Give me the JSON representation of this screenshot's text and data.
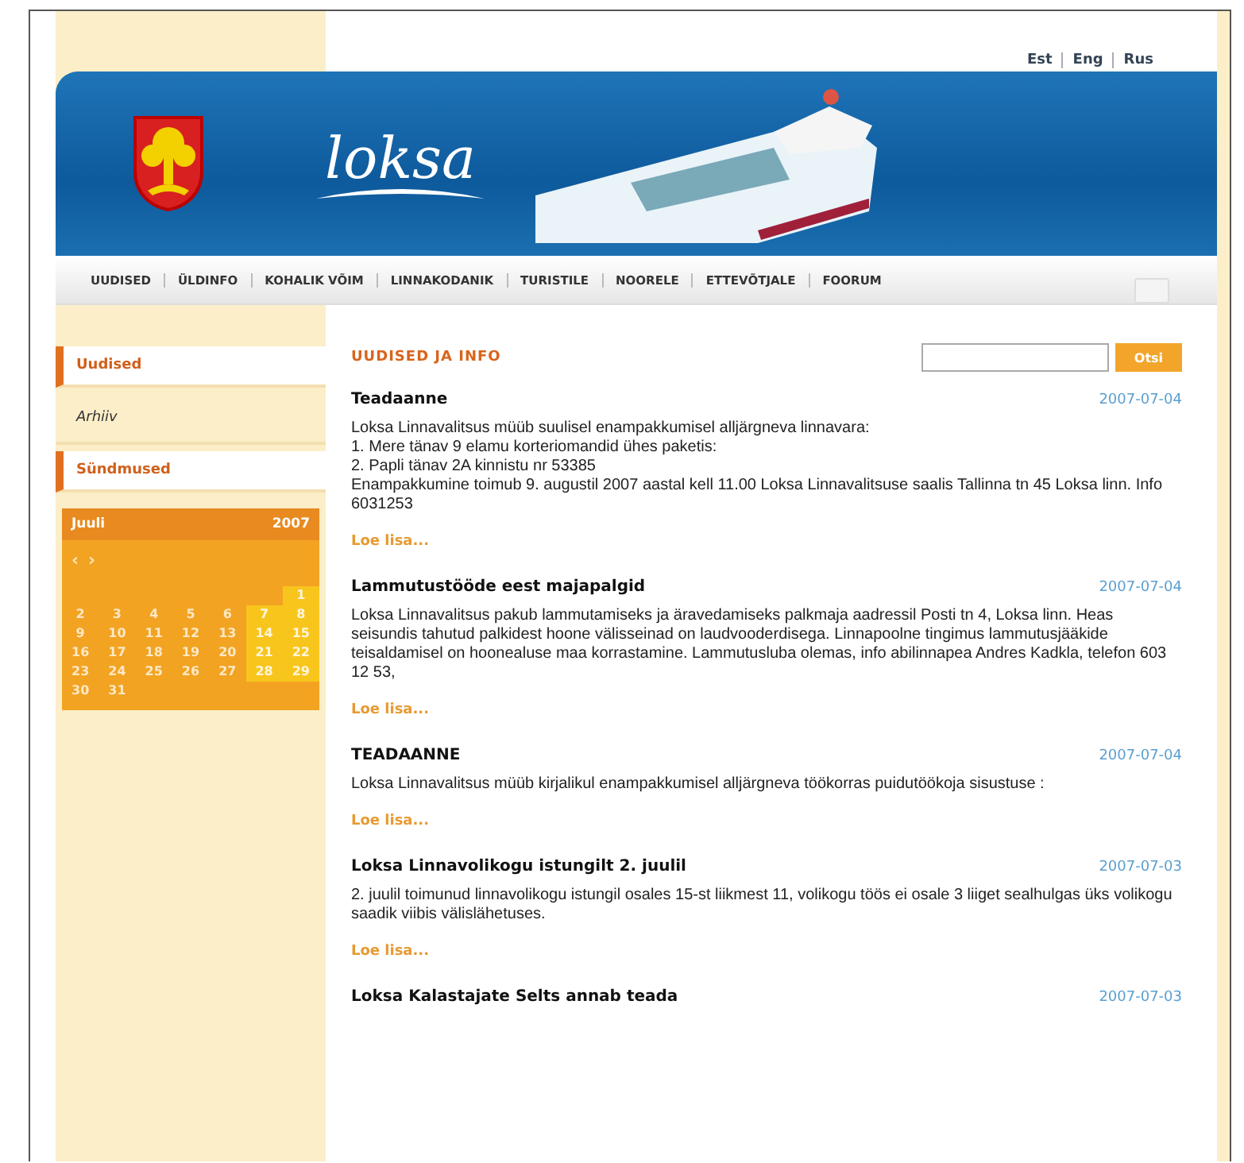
{
  "header": {
    "logo": "loksa",
    "languages": [
      {
        "label": "Est"
      },
      {
        "label": "Eng"
      },
      {
        "label": "Rus"
      }
    ]
  },
  "nav": [
    {
      "label": "UUDISED"
    },
    {
      "label": "ÜLDINFO"
    },
    {
      "label": "KOHALIK VÕIM"
    },
    {
      "label": "LINNAKODANIK"
    },
    {
      "label": "TURISTILE"
    },
    {
      "label": "NOORELE"
    },
    {
      "label": "ETTEVÕTJALE"
    },
    {
      "label": "FOORUM"
    }
  ],
  "sidebar": {
    "items": [
      {
        "label": "Uudised",
        "kind": "section"
      },
      {
        "label": "Arhiiv",
        "kind": "sub"
      },
      {
        "label": "Sündmused",
        "kind": "section"
      }
    ]
  },
  "calendar": {
    "month": "Juuli",
    "year": "2007",
    "prev": "‹",
    "next": "›",
    "weeks": [
      [
        {
          "day": "1",
          "weekend": true
        }
      ],
      [
        {
          "day": "2",
          "weekend": false
        },
        {
          "day": "3",
          "weekend": false
        },
        {
          "day": "4",
          "weekend": false
        },
        {
          "day": "5",
          "weekend": false
        },
        {
          "day": "6",
          "weekend": false
        },
        {
          "day": "7",
          "weekend": true
        },
        {
          "day": "8",
          "weekend": true
        }
      ],
      [
        {
          "day": "9",
          "weekend": false
        },
        {
          "day": "10",
          "weekend": false
        },
        {
          "day": "11",
          "weekend": false
        },
        {
          "day": "12",
          "weekend": false
        },
        {
          "day": "13",
          "weekend": false
        },
        {
          "day": "14",
          "weekend": true
        },
        {
          "day": "15",
          "weekend": true
        }
      ],
      [
        {
          "day": "16",
          "weekend": false
        },
        {
          "day": "17",
          "weekend": false
        },
        {
          "day": "18",
          "weekend": false
        },
        {
          "day": "19",
          "weekend": false
        },
        {
          "day": "20",
          "weekend": false
        },
        {
          "day": "21",
          "weekend": true
        },
        {
          "day": "22",
          "weekend": true
        }
      ],
      [
        {
          "day": "23",
          "weekend": false
        },
        {
          "day": "24",
          "weekend": false
        },
        {
          "day": "25",
          "weekend": false
        },
        {
          "day": "26",
          "weekend": false
        },
        {
          "day": "27",
          "weekend": false
        },
        {
          "day": "28",
          "weekend": true
        },
        {
          "day": "29",
          "weekend": true
        }
      ],
      [
        {
          "day": "30",
          "weekend": false
        },
        {
          "day": "31",
          "weekend": false
        }
      ]
    ]
  },
  "main": {
    "heading": "UUDISED JA INFO",
    "search": {
      "button": "Otsi"
    },
    "news": [
      {
        "title": "Teadaanne",
        "date": "2007-07-04",
        "body": [
          "Loksa Linnavalitsus müüb suulisel enampakkumisel alljärgneva linnavara:",
          "1. Mere tänav 9 elamu korteriomandid ühes paketis:",
          "2. Papli tänav 2A kinnistu nr 53385",
          "Enampakkumine toimub 9. augustil 2007 aastal kell 11.00 Loksa Linnavalitsuse saalis Tallinna tn 45 Loksa linn. Info 6031253"
        ],
        "more": "Loe lisa..."
      },
      {
        "title": "Lammutustööde eest majapalgid",
        "date": "2007-07-04",
        "body": [
          "Loksa Linnavalitsus pakub lammutamiseks ja äravedamiseks palkmaja aadressil Posti tn 4, Loksa linn. Heas seisundis tahutud palkidest hoone välisseinad on laudvooderdisega. Linnapoolne tingimus lammutusjääkide teisaldamisel on hoonealuse maa korrastamine. Lammutusluba olemas, info abilinnapea Andres Kadkla, telefon 603 12 53,"
        ],
        "more": "Loe lisa..."
      },
      {
        "title": "TEADAANNE",
        "date": "2007-07-04",
        "body": [
          "Loksa Linnavalitsus müüb kirjalikul enampakkumisel alljärgneva töökorras puidutöökoja sisustuse :"
        ],
        "more": "Loe lisa..."
      },
      {
        "title": "Loksa Linnavolikogu istungilt 2. juulil",
        "date": "2007-07-03",
        "body": [
          "2. juulil toimunud linnavolikogu istungil osales 15-st liikmest 11, volikogu töös ei osale 3 liiget sealhulgas üks volikogu saadik viibis välislähetuses."
        ],
        "more": "Loe lisa..."
      },
      {
        "title": "Loksa Kalastajate Selts annab teada",
        "date": "2007-07-03"
      }
    ]
  }
}
